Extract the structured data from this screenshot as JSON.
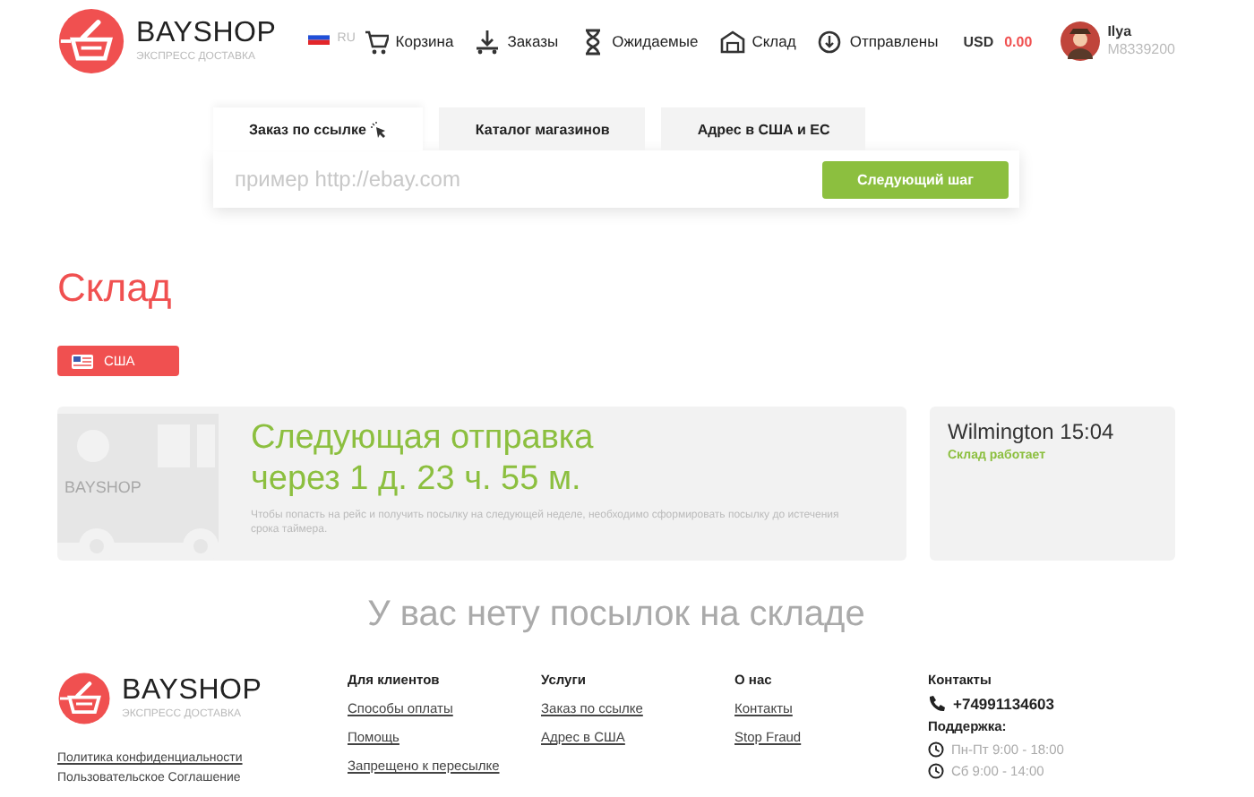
{
  "header": {
    "logo": {
      "name": "BAYSHOP",
      "tagline": "ЭКСПРЕСС ДОСТАВКА"
    },
    "language": "RU",
    "nav": [
      {
        "kind": "cart",
        "label": "Корзина"
      },
      {
        "kind": "dolly",
        "label": "Заказы"
      },
      {
        "kind": "hourglass",
        "label": "Ожидаемые"
      },
      {
        "kind": "warehouse",
        "label": "Склад"
      },
      {
        "kind": "box",
        "label": "Отправлены"
      }
    ],
    "balance": {
      "currency": "USD",
      "amount": "0.00"
    },
    "user": {
      "name": "Ilya",
      "id": "M8339200"
    }
  },
  "order": {
    "tabs": [
      {
        "label": "Заказ по ссылке",
        "selected": true
      },
      {
        "label": "Каталог магазинов",
        "selected": false
      },
      {
        "label": "Адрес в США и ЕС",
        "selected": false
      }
    ],
    "placeholder": "пример http://ebay.com",
    "button": "Следующий шаг"
  },
  "page_title": "Склад",
  "countries": [
    {
      "label": "США",
      "selected": true
    }
  ],
  "shipment": {
    "title_lines": [
      "Следующая отправка",
      "через 1 д. 23 ч. 55 м."
    ],
    "note": "Чтобы попасть на рейс и получить посылку на следующей неделе, необходимо сформировать посылку до истечения срока таймера.",
    "truck_label": "BAYSHOP"
  },
  "warehouse": {
    "city_time": "Wilmington 15:04",
    "status": "Склад работает"
  },
  "empty_message": "У вас нету посылок на складе",
  "footer": {
    "logo": {
      "name": "BAYSHOP",
      "tagline": "ЭКСПРЕСС ДОСТАВКА"
    },
    "legal": [
      {
        "kind": "link",
        "label": "Политика конфиденциальности"
      },
      {
        "kind": "text",
        "label": "Пользовательское Соглашение"
      }
    ],
    "columns": [
      {
        "title": "Для клиентов",
        "links": [
          "Способы оплаты",
          "Помощь",
          "Запрещено к пересылке"
        ]
      },
      {
        "title": "Услуги",
        "links": [
          "Заказ по ссылке",
          "Адрес в США"
        ]
      },
      {
        "title": "О нас",
        "links": [
          "Контакты",
          "Stop Fraud"
        ]
      }
    ],
    "contacts": {
      "title": "Контакты",
      "phone": "+74991134603",
      "support_title": "Поддержка:",
      "hours": [
        "Пн-Пт 9:00 - 18:00",
        "Сб 9:00 - 14:00"
      ]
    }
  }
}
